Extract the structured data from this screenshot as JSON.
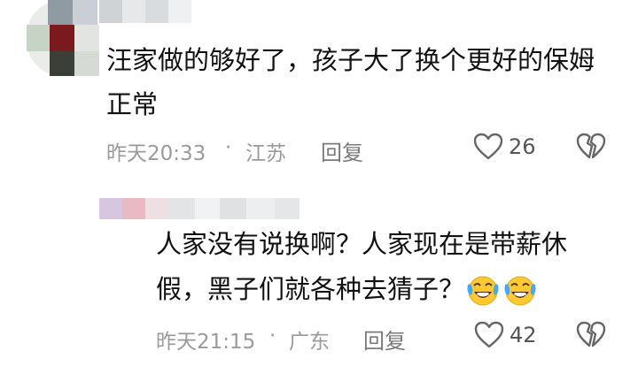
{
  "comments": [
    {
      "text_line1": "汪家做的够好了，孩子大了换个更好的保姆",
      "text_line2": "正常",
      "time": "昨天20:33",
      "location": "江苏",
      "reply_label": "回复",
      "like_count": "26"
    },
    {
      "text_line1": "人家没有说换啊？人家现在是带薪休",
      "text_line2": "假，黑子们就各种去猜子？",
      "time": "昨天21:15",
      "location": "广东",
      "reply_label": "回复",
      "like_count": "42"
    }
  ],
  "separator": "·",
  "icons": {
    "like": "heart-outline-icon",
    "dislike": "broken-heart-icon",
    "emoji": "laughing-crying-emoji-icon"
  },
  "colors": {
    "text": "#111111",
    "meta": "#9a9a9a",
    "icon": "#666666"
  }
}
